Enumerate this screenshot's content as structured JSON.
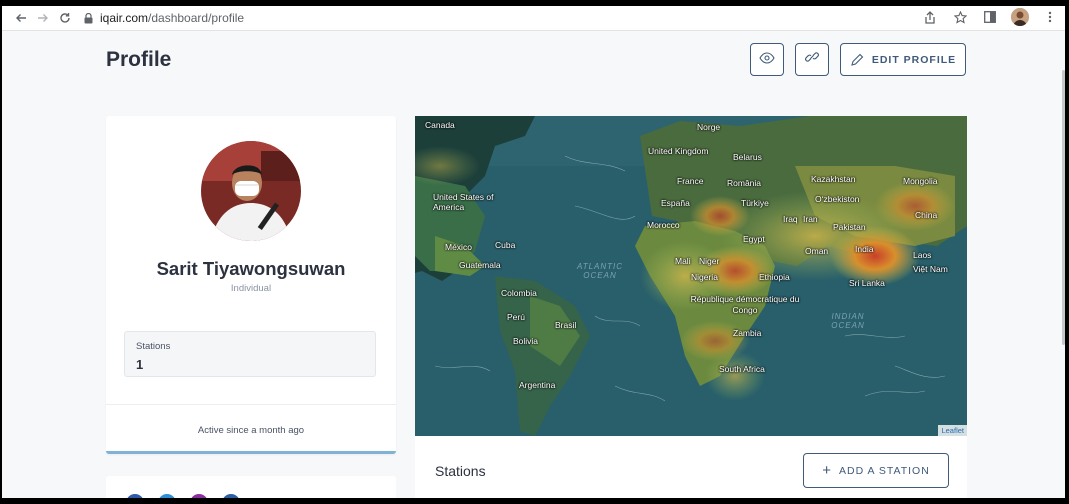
{
  "browser": {
    "url_host": "iqair.com",
    "url_path": "/dashboard/profile",
    "icons": [
      "back-icon",
      "forward-icon",
      "reload-icon",
      "lock-icon",
      "share-icon",
      "star-icon",
      "sidebar-icon",
      "profile-avatar",
      "more-icon"
    ]
  },
  "header": {
    "title": "Profile",
    "edit_label": "EDIT PROFILE"
  },
  "profile": {
    "name": "Sarit Tiyawongsuwan",
    "type": "Individual",
    "stations_label": "Stations",
    "stations_value": "1",
    "active_since": "Active since a month ago"
  },
  "map": {
    "attribution": "Leaflet",
    "labels": [
      {
        "text": "Canada"
      },
      {
        "text": "Norge"
      },
      {
        "text": "United Kingdom"
      },
      {
        "text": "Belarus"
      },
      {
        "text": "France"
      },
      {
        "text": "România"
      },
      {
        "text": "Kazakhstan"
      },
      {
        "text": "Mongolia"
      },
      {
        "text": "United States of America"
      },
      {
        "text": "España"
      },
      {
        "text": "Türkiye"
      },
      {
        "text": "Oʻzbekiston"
      },
      {
        "text": "China"
      },
      {
        "text": "Morocco"
      },
      {
        "text": "Iraq"
      },
      {
        "text": "Iran"
      },
      {
        "text": "Pakistan"
      },
      {
        "text": "Egypt"
      },
      {
        "text": "México"
      },
      {
        "text": "Cuba"
      },
      {
        "text": "Oman"
      },
      {
        "text": "India"
      },
      {
        "text": "Laos"
      },
      {
        "text": "Guatemala"
      },
      {
        "text": "Mali"
      },
      {
        "text": "Niger"
      },
      {
        "text": "Việt Nam"
      },
      {
        "text": "Nigeria"
      },
      {
        "text": "Ethiopia"
      },
      {
        "text": "Sri Lanka"
      },
      {
        "text": "Colombia"
      },
      {
        "text": "République démocratique du Congo"
      },
      {
        "text": "Perú"
      },
      {
        "text": "Brasil"
      },
      {
        "text": "Zambia"
      },
      {
        "text": "Bolivia"
      },
      {
        "text": "South Africa"
      },
      {
        "text": "Argentina"
      }
    ],
    "oceans": [
      {
        "text": "ATLANTIC OCEAN"
      },
      {
        "text": "INDIAN OCEAN"
      }
    ]
  },
  "stations_panel": {
    "heading": "Stations",
    "add_label": "ADD A STATION"
  },
  "colors": {
    "primary_outline": "#3f5a7a",
    "card_accent": "#7fb3d6",
    "page_bg": "#f7f8fa"
  }
}
